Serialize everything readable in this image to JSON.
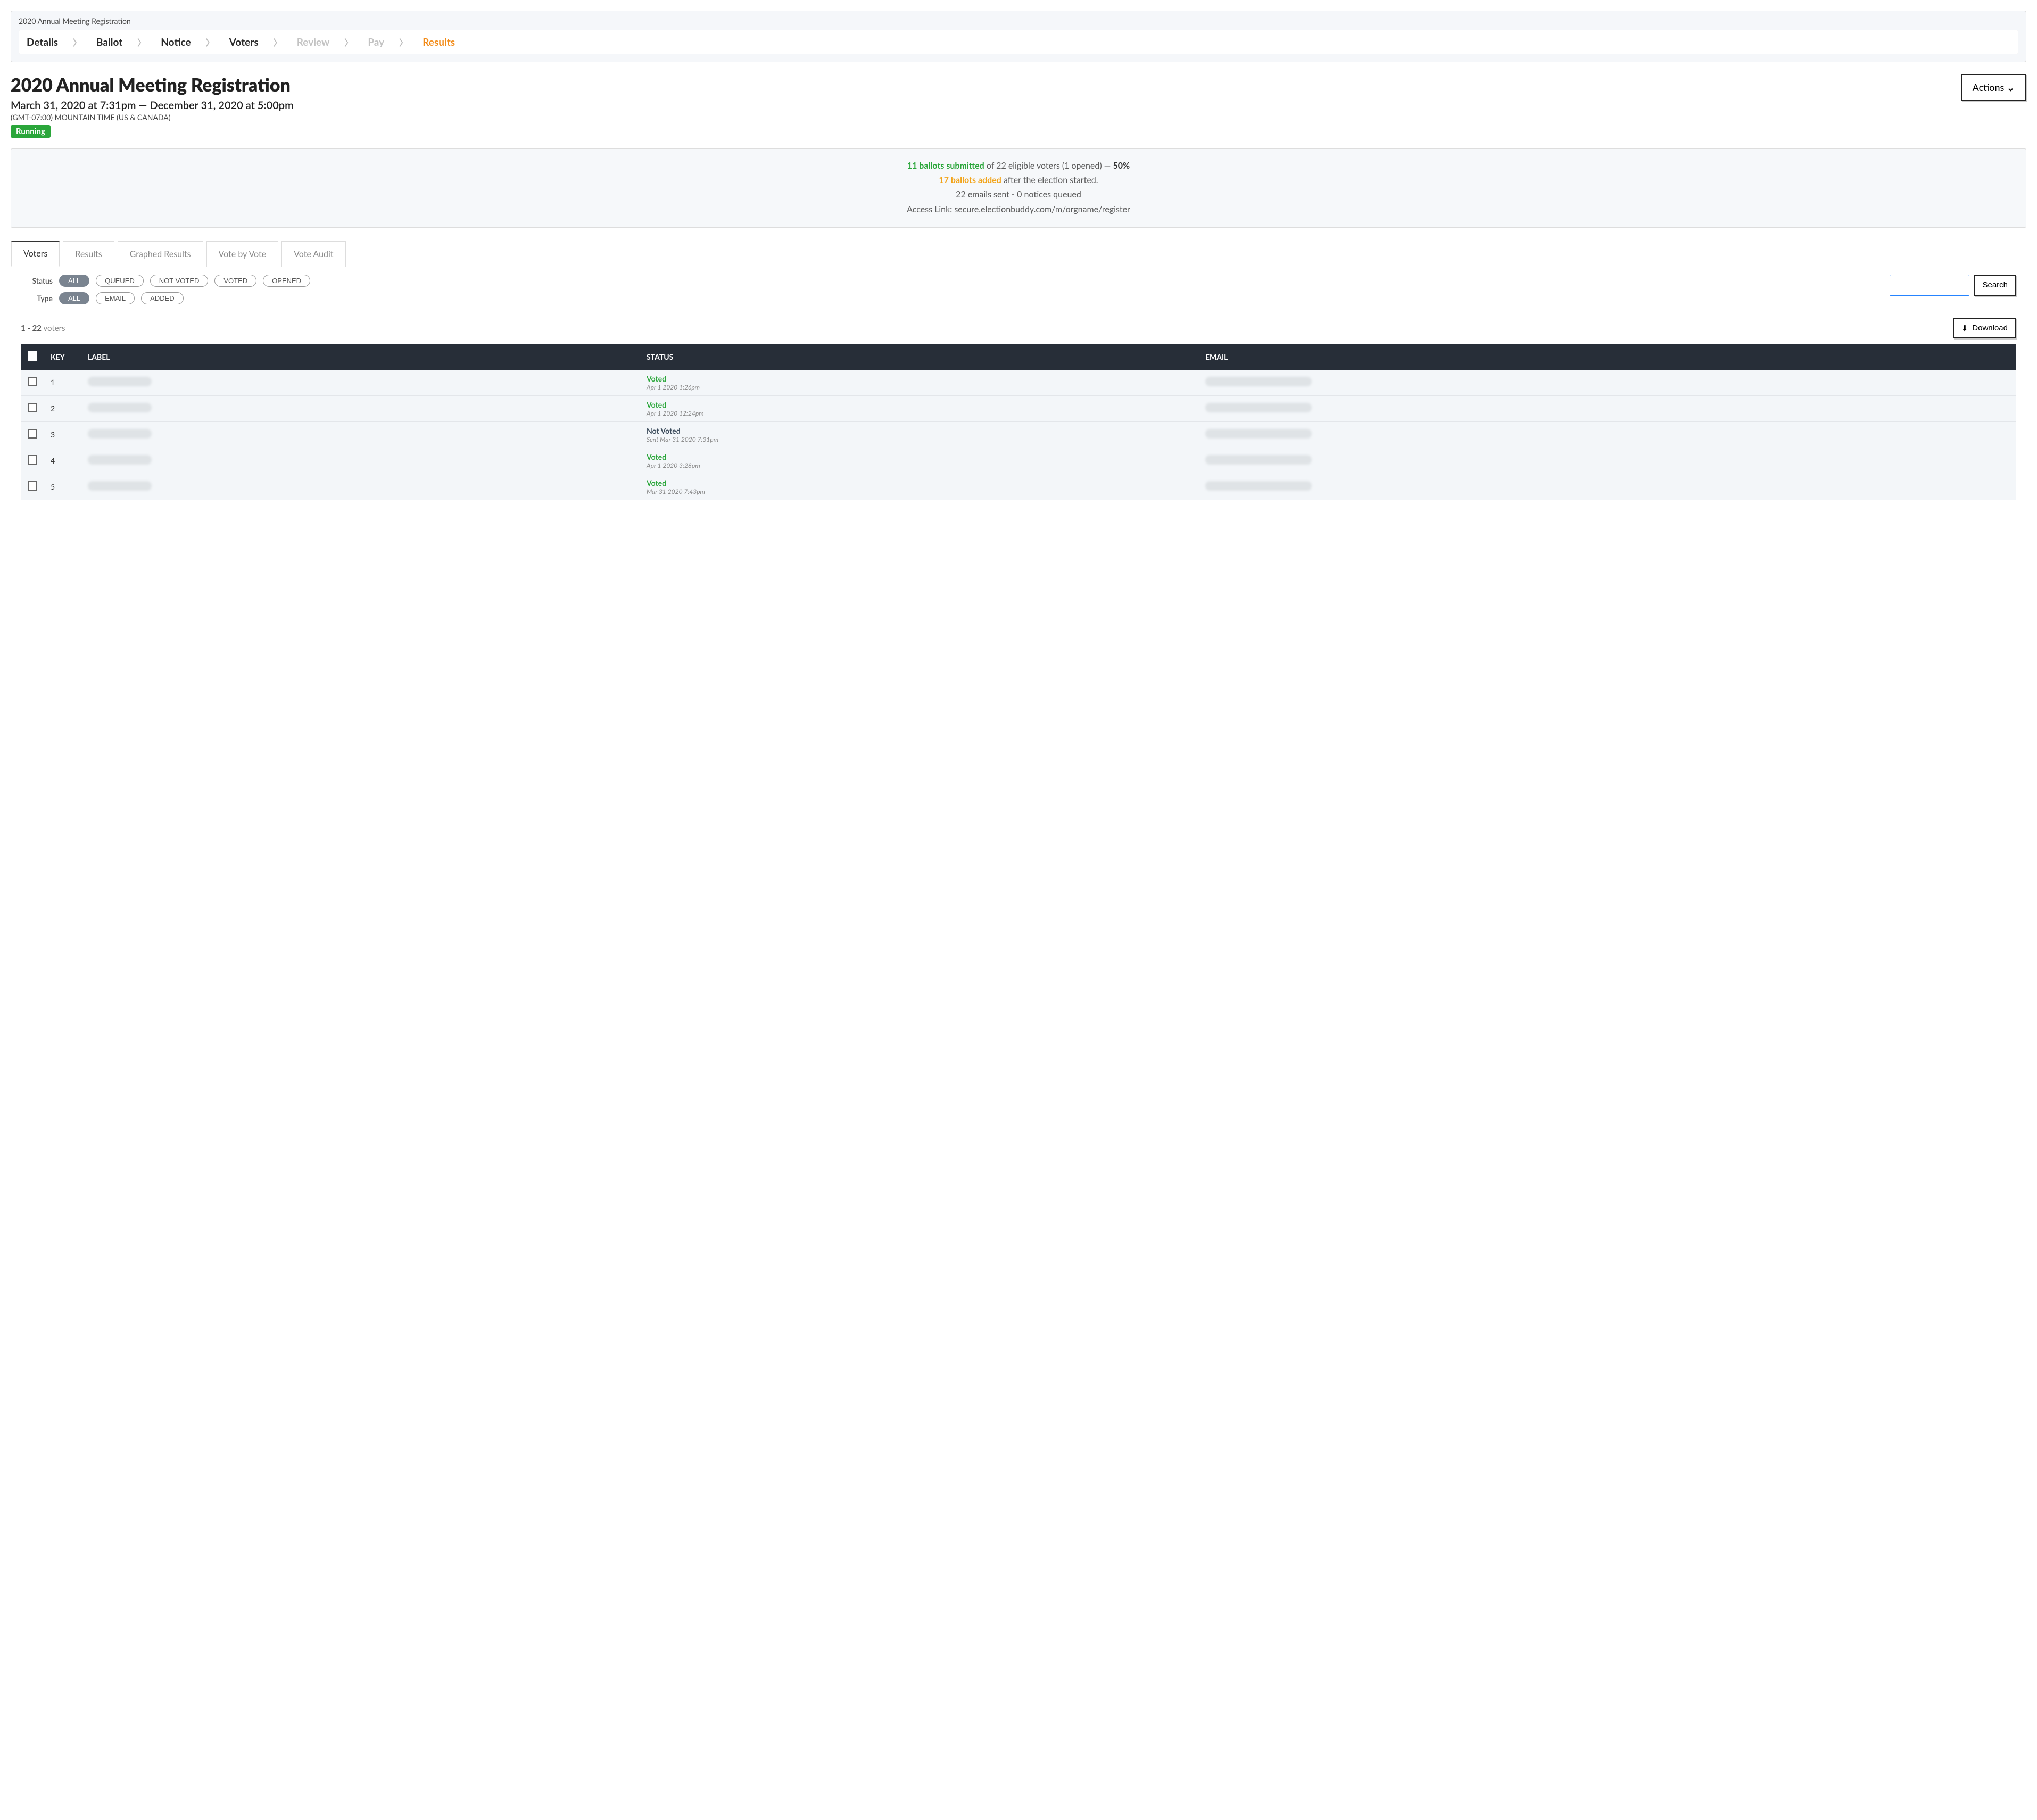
{
  "stepbar": {
    "title": "2020 Annual Meeting Registration",
    "steps": [
      {
        "label": "Details",
        "state": "normal"
      },
      {
        "label": "Ballot",
        "state": "normal"
      },
      {
        "label": "Notice",
        "state": "normal"
      },
      {
        "label": "Voters",
        "state": "normal"
      },
      {
        "label": "Review",
        "state": "disabled"
      },
      {
        "label": "Pay",
        "state": "disabled"
      },
      {
        "label": "Results",
        "state": "active"
      }
    ]
  },
  "header": {
    "title": "2020 Annual Meeting Registration",
    "date_range": "March 31, 2020 at 7:31pm — December 31, 2020 at 5:00pm",
    "timezone": "(GMT-07:00) MOUNTAIN TIME (US & CANADA)",
    "status": "Running",
    "actions_label": "Actions"
  },
  "summary": {
    "ballots_submitted_phrase": "11 ballots submitted",
    "eligible_phrase": " of 22 eligible voters (1 opened) — ",
    "percent": "50%",
    "added_phrase_strong": "17 ballots added",
    "added_phrase_rest": " after the election started.",
    "emails_line": "22 emails sent - 0 notices queued",
    "link_label": "Access Link: ",
    "link_url": "secure.electionbuddy.com/m/orgname/register"
  },
  "tabs": [
    "Voters",
    "Results",
    "Graphed Results",
    "Vote by Vote",
    "Vote Audit"
  ],
  "filters": {
    "status_label": "Status",
    "status_options": [
      "ALL",
      "QUEUED",
      "NOT VOTED",
      "VOTED",
      "OPENED"
    ],
    "status_active": "ALL",
    "type_label": "Type",
    "type_options": [
      "ALL",
      "EMAIL",
      "ADDED"
    ],
    "type_active": "ALL",
    "search_button": "Search",
    "download_button": "Download"
  },
  "list_summary": {
    "range": "1 - 22",
    "word": "voters"
  },
  "table": {
    "headers": [
      "KEY",
      "LABEL",
      "STATUS",
      "EMAIL"
    ],
    "rows": [
      {
        "key": "1",
        "status": "Voted",
        "sub": "Apr 1 2020 1:26pm"
      },
      {
        "key": "2",
        "status": "Voted",
        "sub": "Apr 1 2020 12:24pm"
      },
      {
        "key": "3",
        "status": "Not Voted",
        "sub": "Sent Mar 31 2020 7:31pm"
      },
      {
        "key": "4",
        "status": "Voted",
        "sub": "Apr 1 2020 3:28pm"
      },
      {
        "key": "5",
        "status": "Voted",
        "sub": "Mar 31 2020 7:43pm"
      }
    ]
  }
}
